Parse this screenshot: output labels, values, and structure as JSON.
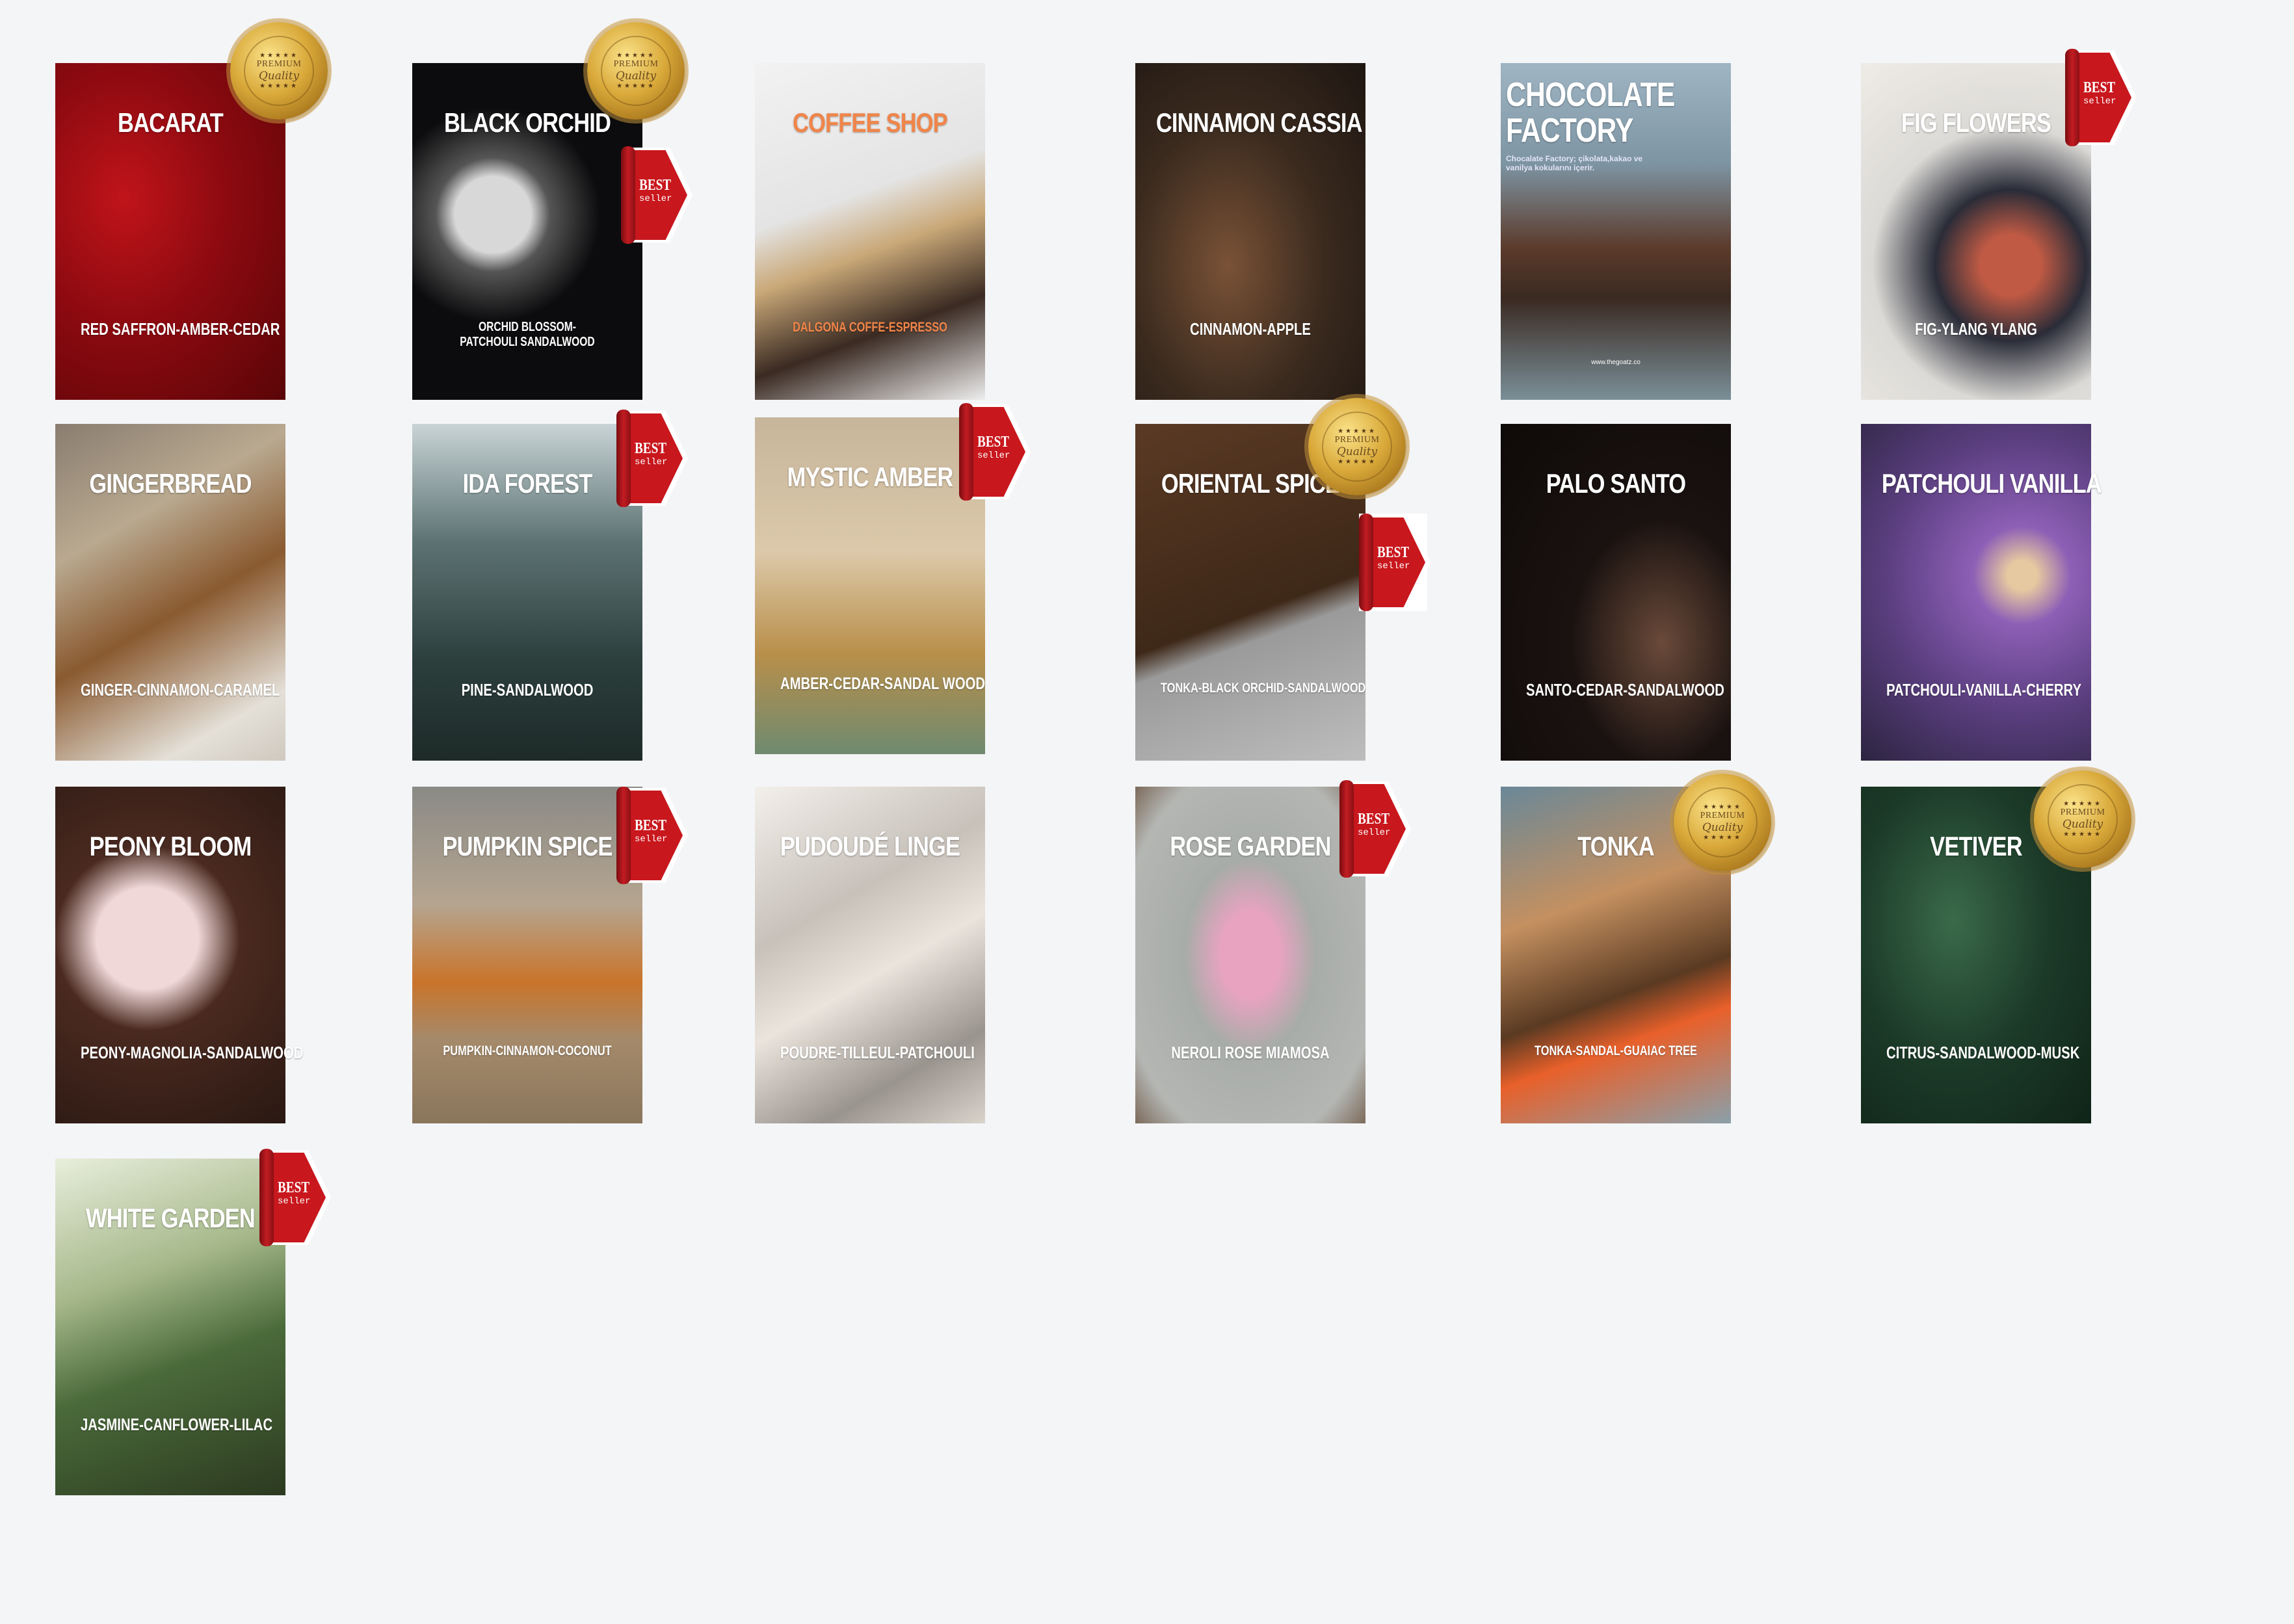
{
  "background_color": "#f4f5f7",
  "badges": {
    "premium": {
      "line1": "PREMIUM",
      "line2": "Quality",
      "stars": "★★★★★",
      "icon": "premium-quality-seal-icon"
    },
    "bestseller": {
      "line1": "BEST",
      "line2": "seller",
      "icon": "best-seller-ribbon-icon"
    }
  },
  "products": [
    {
      "title": "BACARAT",
      "notes": "RED SAFFRON-AMBER-CEDAR",
      "premium": true,
      "bestseller": false
    },
    {
      "title": "BLACK ORCHID",
      "notes": "ORCHID BLOSSOM-PATCHOULI SANDALWOOD",
      "premium": true,
      "bestseller": true
    },
    {
      "title": "COFFEE SHOP",
      "notes": "DALGONA COFFE-ESPRESSO",
      "premium": false,
      "bestseller": false,
      "text_color": "#f0854a"
    },
    {
      "title": "CINNAMON CASSIA",
      "notes": "CINNAMON-APPLE",
      "premium": false,
      "bestseller": false
    },
    {
      "title": "CHOCOLATE FACTORY",
      "description": "Chocalate Factory; çikolata,kakao ve vanilya kokularını içerir.",
      "url": "www.thegoatz.co",
      "premium": false,
      "bestseller": false
    },
    {
      "title": "FIG FLOWERS",
      "notes": "FIG-YLANG YLANG",
      "premium": false,
      "bestseller": true
    },
    {
      "title": "GINGERBREAD",
      "notes": "GINGER-CINNAMON-CARAMEL",
      "premium": false,
      "bestseller": false
    },
    {
      "title": "IDA FOREST",
      "notes": "PINE-SANDALWOOD",
      "premium": false,
      "bestseller": true
    },
    {
      "title": "MYSTIC AMBER",
      "notes": "AMBER-CEDAR-SANDAL WOOD",
      "premium": false,
      "bestseller": true
    },
    {
      "title": "ORIENTAL SPICE",
      "notes": "TONKA-BLACK ORCHID-SANDALWOOD",
      "premium": true,
      "bestseller": true
    },
    {
      "title": "PALO SANTO",
      "notes": "SANTO-CEDAR-SANDALWOOD",
      "premium": false,
      "bestseller": false
    },
    {
      "title": "PATCHOULI VANILLA",
      "notes": "PATCHOULI-VANILLA-CHERRY",
      "premium": false,
      "bestseller": false
    },
    {
      "title": "PEONY BLOOM",
      "notes": "PEONY-MAGNOLIA-SANDALWOOD",
      "premium": false,
      "bestseller": false
    },
    {
      "title": "PUMPKIN SPICE",
      "notes": "PUMPKIN-CINNAMON-COCONUT",
      "premium": false,
      "bestseller": true
    },
    {
      "title": "PUDOUDÉ LINGE",
      "notes": "POUDRE-TILLEUL-PATCHOULI",
      "premium": false,
      "bestseller": false
    },
    {
      "title": "ROSE GARDEN",
      "notes": "NEROLI ROSE MIAMOSA",
      "premium": false,
      "bestseller": true
    },
    {
      "title": "TONKA",
      "notes": "TONKA-SANDAL-GUAIAC TREE",
      "premium": true,
      "bestseller": false
    },
    {
      "title": "VETIVER",
      "notes": "CITRUS-SANDALWOOD-MUSK",
      "premium": true,
      "bestseller": false
    },
    {
      "title": "WHITE GARDEN",
      "notes": "JASMINE-CANFLOWER-LILAC",
      "premium": false,
      "bestseller": true
    }
  ]
}
